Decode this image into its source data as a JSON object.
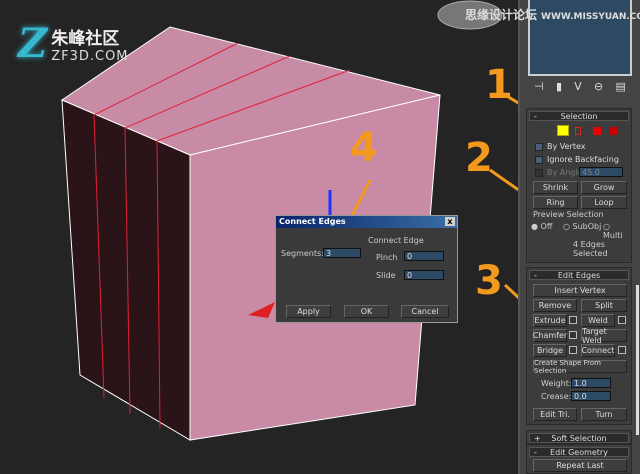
{
  "logo": {
    "cn": "朱峰社区",
    "en": "ZF3D.COM",
    "z": "Z"
  },
  "watermark": {
    "cn": "思缘设计论坛",
    "en": "WWW.MISSYUAN.COM"
  },
  "annotations": [
    "1",
    "2",
    "3",
    "4"
  ],
  "dialog": {
    "title": "Connect Edges",
    "group": "Connect Edge",
    "segments_label": "Segments:",
    "segments": "3",
    "pinch_label": "Pinch",
    "pinch": "0",
    "slide_label": "Slide",
    "slide": "0",
    "apply": "Apply",
    "ok": "OK",
    "cancel": "Cancel",
    "close": "x"
  },
  "panel": {
    "selection": {
      "title": "Selection",
      "by_vertex": "By Vertex",
      "ignore_backfacing": "Ignore Backfacing",
      "by_angle": "By Angle:",
      "angle": "45.0",
      "shrink": "Shrink",
      "grow": "Grow",
      "ring": "Ring",
      "loop": "Loop",
      "preview": "Preview Selection",
      "off": "Off",
      "subobj": "SubObj",
      "multi": "Multi",
      "status": "4 Edges Selected"
    },
    "edit_edges": {
      "title": "Edit Edges",
      "insert_vertex": "Insert Vertex",
      "remove": "Remove",
      "split": "Split",
      "extrude": "Extrude",
      "weld": "Weld",
      "chamfer": "Chamfer",
      "target_weld": "Target Weld",
      "bridge": "Bridge",
      "connect": "Connect",
      "create_shape": "Create Shape From Selection",
      "weight_label": "Weight:",
      "weight": "1.0",
      "crease_label": "Crease:",
      "crease": "0.0",
      "edit_tri": "Edit Tri.",
      "turn": "Turn"
    },
    "soft_selection": "Soft Selection",
    "edit_geometry": "Edit Geometry",
    "repeat_last": "Repeat Last",
    "plus": "+",
    "minus": "-"
  },
  "colors": {
    "accent": "#f39a1e",
    "box": "#c98aa6",
    "edge": "#e0203a"
  }
}
